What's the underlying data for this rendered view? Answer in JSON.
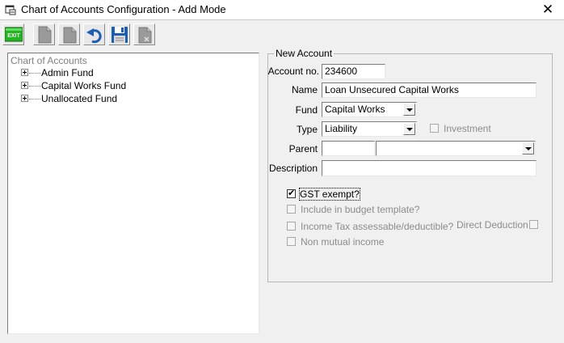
{
  "window": {
    "title": "Chart of Accounts Configuration - Add Mode",
    "close_glyph": "✕",
    "icon": "app-window-icon"
  },
  "toolbar": {
    "exit_label": "EXIT",
    "buttons": [
      "exit-icon",
      "new-icon",
      "copy-icon",
      "undo-icon",
      "save-icon",
      "delete-icon"
    ]
  },
  "tree": {
    "root_label": "Chart of Accounts",
    "nodes": [
      {
        "label": "Admin Fund"
      },
      {
        "label": "Capital Works Fund"
      },
      {
        "label": "Unallocated Fund"
      }
    ]
  },
  "form": {
    "group_title": "New Account",
    "account_no": {
      "label": "Account no.",
      "value": "234600"
    },
    "name": {
      "label": "Name",
      "value": "Loan Unsecured Capital Works"
    },
    "fund": {
      "label": "Fund",
      "value": "Capital Works"
    },
    "type": {
      "label": "Type",
      "value": "Liability"
    },
    "investment": {
      "label": "Investment",
      "checked": false,
      "enabled": false
    },
    "parent": {
      "label": "Parent",
      "value": "",
      "select_value": ""
    },
    "description": {
      "label": "Description",
      "value": ""
    },
    "gst_exempt": {
      "label": "GST exempt?",
      "checked": true,
      "enabled": true,
      "check_glyph": "✔"
    },
    "budget_template": {
      "label": "Include in budget template?",
      "checked": false,
      "enabled": false
    },
    "income_tax": {
      "label": "Income Tax assessable/deductible?",
      "checked": false,
      "enabled": false
    },
    "direct_deduction": {
      "label": "Direct Deduction",
      "checked": false,
      "enabled": false
    },
    "non_mutual": {
      "label": "Non mutual income",
      "checked": false,
      "enabled": false
    }
  },
  "colors": {
    "exit_button": "#21b521",
    "toolbar_disabled": "#9a9a9a",
    "toolbar_active": "#1a5fb4"
  }
}
